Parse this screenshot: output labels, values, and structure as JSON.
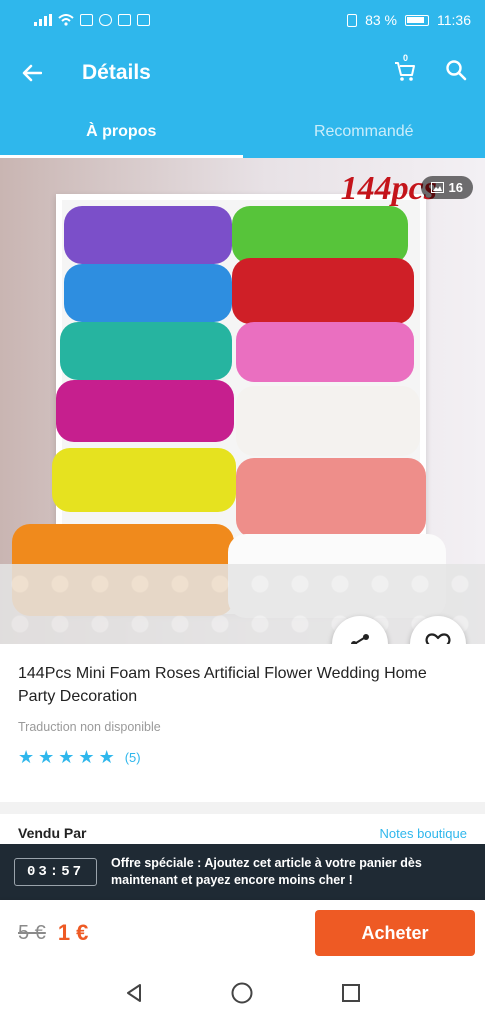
{
  "status_bar": {
    "battery": "83 %",
    "time": "11:36",
    "icons": [
      "signal-icon",
      "wifi-icon",
      "notification-icon",
      "shield-icon",
      "facebook-icon",
      "ms-icon",
      "vibrate-icon",
      "battery-icon"
    ]
  },
  "app_bar": {
    "title": "Détails",
    "icons": [
      "back-arrow-icon",
      "cart-icon",
      "search-icon"
    ],
    "cart_badge": "0"
  },
  "tabs": [
    {
      "label": "À propos",
      "active": true
    },
    {
      "label": "Recommandé",
      "active": false
    }
  ],
  "image": {
    "watermark": "144pcs",
    "photo_count": "16",
    "icons": [
      "image-gallery-icon",
      "share-icon",
      "heart-icon"
    ]
  },
  "product": {
    "title": "144Pcs Mini Foam Roses Artificial Flower Wedding Home Party Decoration",
    "translation_note": "Traduction non disponible",
    "rating_stars": 5,
    "rating_count": "(5)"
  },
  "seller": {
    "label": "Vendu Par",
    "link": "Notes boutique"
  },
  "offer": {
    "timer": "03:57",
    "text": "Offre spéciale : Ajoutez cet article à votre panier dès maintenant et payez encore moins cher !"
  },
  "purchase": {
    "old_price": "5 €",
    "new_price": "1 €",
    "button": "Acheter"
  },
  "colors": {
    "brand": "#2fb7ec",
    "cta": "#ee5a24",
    "banner": "#1f2a34"
  }
}
